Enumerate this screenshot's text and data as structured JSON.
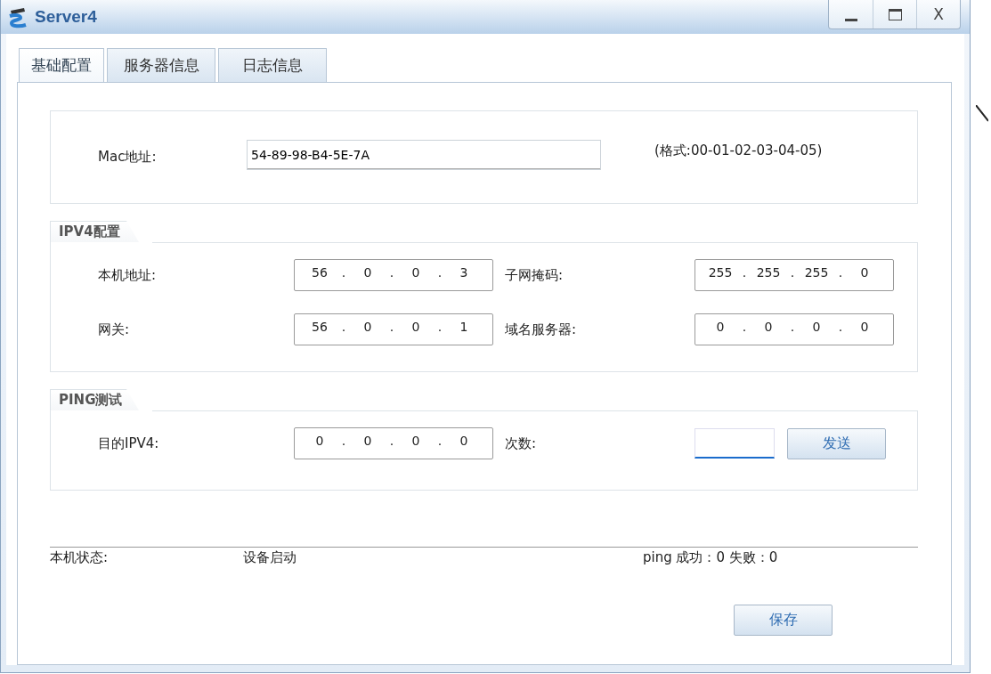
{
  "window": {
    "title": "Server4",
    "controls": [
      {
        "kind": "minimize"
      },
      {
        "kind": "maximize"
      },
      {
        "kind": "close",
        "label": "X"
      }
    ]
  },
  "tabs": [
    {
      "label": "基础配置",
      "selected": true
    },
    {
      "label": "服务器信息",
      "selected": false
    },
    {
      "label": "日志信息",
      "selected": false
    }
  ],
  "ip_separator": ".",
  "mac": {
    "label": "Mac地址:",
    "value": "54-89-98-B4-5E-7A",
    "hint": "(格式:00-01-02-03-04-05)"
  },
  "ipv4": {
    "title": "IPV4配置",
    "fields": [
      {
        "label": "本机地址:",
        "octets": [
          "56",
          "0",
          "0",
          "3"
        ]
      },
      {
        "label": "子网掩码:",
        "octets": [
          "255",
          "255",
          "255",
          "0"
        ]
      },
      {
        "label": "网关:",
        "octets": [
          "56",
          "0",
          "0",
          "1"
        ]
      },
      {
        "label": "域名服务器:",
        "octets": [
          "0",
          "0",
          "0",
          "0"
        ]
      }
    ]
  },
  "ping": {
    "title": "PING测试",
    "target": {
      "label": "目的IPV4:",
      "octets": [
        "0",
        "0",
        "0",
        "0"
      ]
    },
    "count": {
      "label": "次数:",
      "focused": true
    },
    "send_button": "发送"
  },
  "status": {
    "label": "本机状态:",
    "value": "设备启动",
    "result": "ping 成功：0 失败：0"
  },
  "save_button": "保存"
}
